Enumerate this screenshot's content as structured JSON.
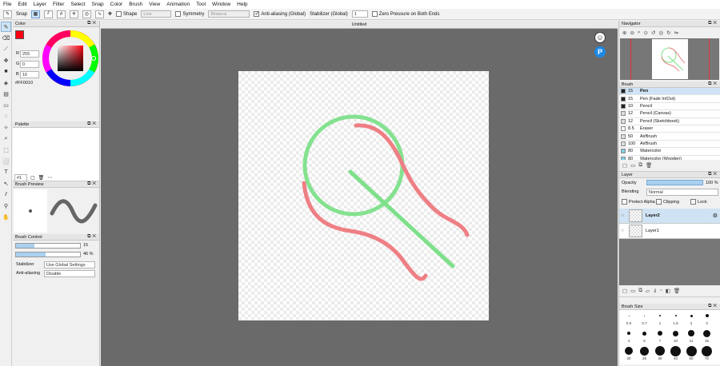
{
  "menu": [
    "File",
    "Edit",
    "Layer",
    "Filter",
    "Select",
    "Snap",
    "Color",
    "Brush",
    "View",
    "Animation",
    "Tool",
    "Window",
    "Help"
  ],
  "toolbar": {
    "snap_label": "Snap",
    "shape_label": "Shape",
    "shape_value": "Line",
    "symmetry_label": "Symmetry",
    "symmetry_value": "Bilateral",
    "antialias_label": "Anti-aliasing (Global)",
    "stabilizer_label": "Stabilizer (Global)",
    "stabilizer_value": "1",
    "zero_pressure_label": "Zero Pressure on Both Ends"
  },
  "color_panel": {
    "title": "Color",
    "r_label": "R",
    "r_value": "255",
    "g_label": "G",
    "g_value": "0",
    "b_label": "B",
    "b_value": "16",
    "hex": "#FF0010",
    "fg_color": "#ff0010"
  },
  "palette_panel": {
    "title": "Palette",
    "palette_index": "#1"
  },
  "brush_preview": {
    "title": "Brush Preview"
  },
  "brush_control": {
    "title": "Brush Control",
    "size_value": "15",
    "opacity_value": "46 %",
    "opacity_fraction": 0.46,
    "stabilizer_label": "Stabilizer",
    "stabilizer_value": "Use Global Settings",
    "antialias_label": "Anti-aliasing",
    "antialias_value": "Disable"
  },
  "document": {
    "tab": "Untitled"
  },
  "navigator": {
    "title": "Navigator"
  },
  "brush_panel": {
    "title": "Brush",
    "items": [
      {
        "size": "15",
        "name": "Pen",
        "color": "#222222",
        "selected": true
      },
      {
        "size": "15",
        "name": "Pen (Fade In/Out)",
        "color": "#222222"
      },
      {
        "size": "10",
        "name": "Pencil",
        "color": "#222222"
      },
      {
        "size": "12",
        "name": "Pencil (Canvas)",
        "color": "#dddddd"
      },
      {
        "size": "12",
        "name": "Pencil (Sketchbook)",
        "color": "#dddddd"
      },
      {
        "size": "8.5",
        "name": "Eraser",
        "color": "#ffffff"
      },
      {
        "size": "50",
        "name": "AirBrush",
        "color": "#dddddd"
      },
      {
        "size": "100",
        "name": "AirBrush",
        "color": "#dddddd"
      },
      {
        "size": "80",
        "name": "Watercolor",
        "color": "#7fd0e6"
      },
      {
        "size": "80",
        "name": "Watercolor (Wooden)",
        "color": "#7fd0e6"
      }
    ]
  },
  "layer_panel": {
    "title": "Layer",
    "opacity_label": "Opacity",
    "opacity_value": "100 %",
    "blending_label": "Blending",
    "blending_value": "Normal",
    "protect_alpha_label": "Protect Alpha",
    "clipping_label": "Clipping",
    "lock_label": "Lock",
    "layers": [
      {
        "name": "Layer2",
        "selected": true
      },
      {
        "name": "Layer1",
        "selected": false
      }
    ]
  },
  "brush_size_panel": {
    "title": "Brush Size",
    "rows": [
      [
        "0.5",
        "0.7",
        "1",
        "1.5",
        "2",
        "3"
      ],
      [
        "4",
        "5",
        "7",
        "10",
        "11",
        "15"
      ],
      [
        "20",
        "25",
        "30",
        "40",
        "50",
        "70"
      ]
    ]
  }
}
